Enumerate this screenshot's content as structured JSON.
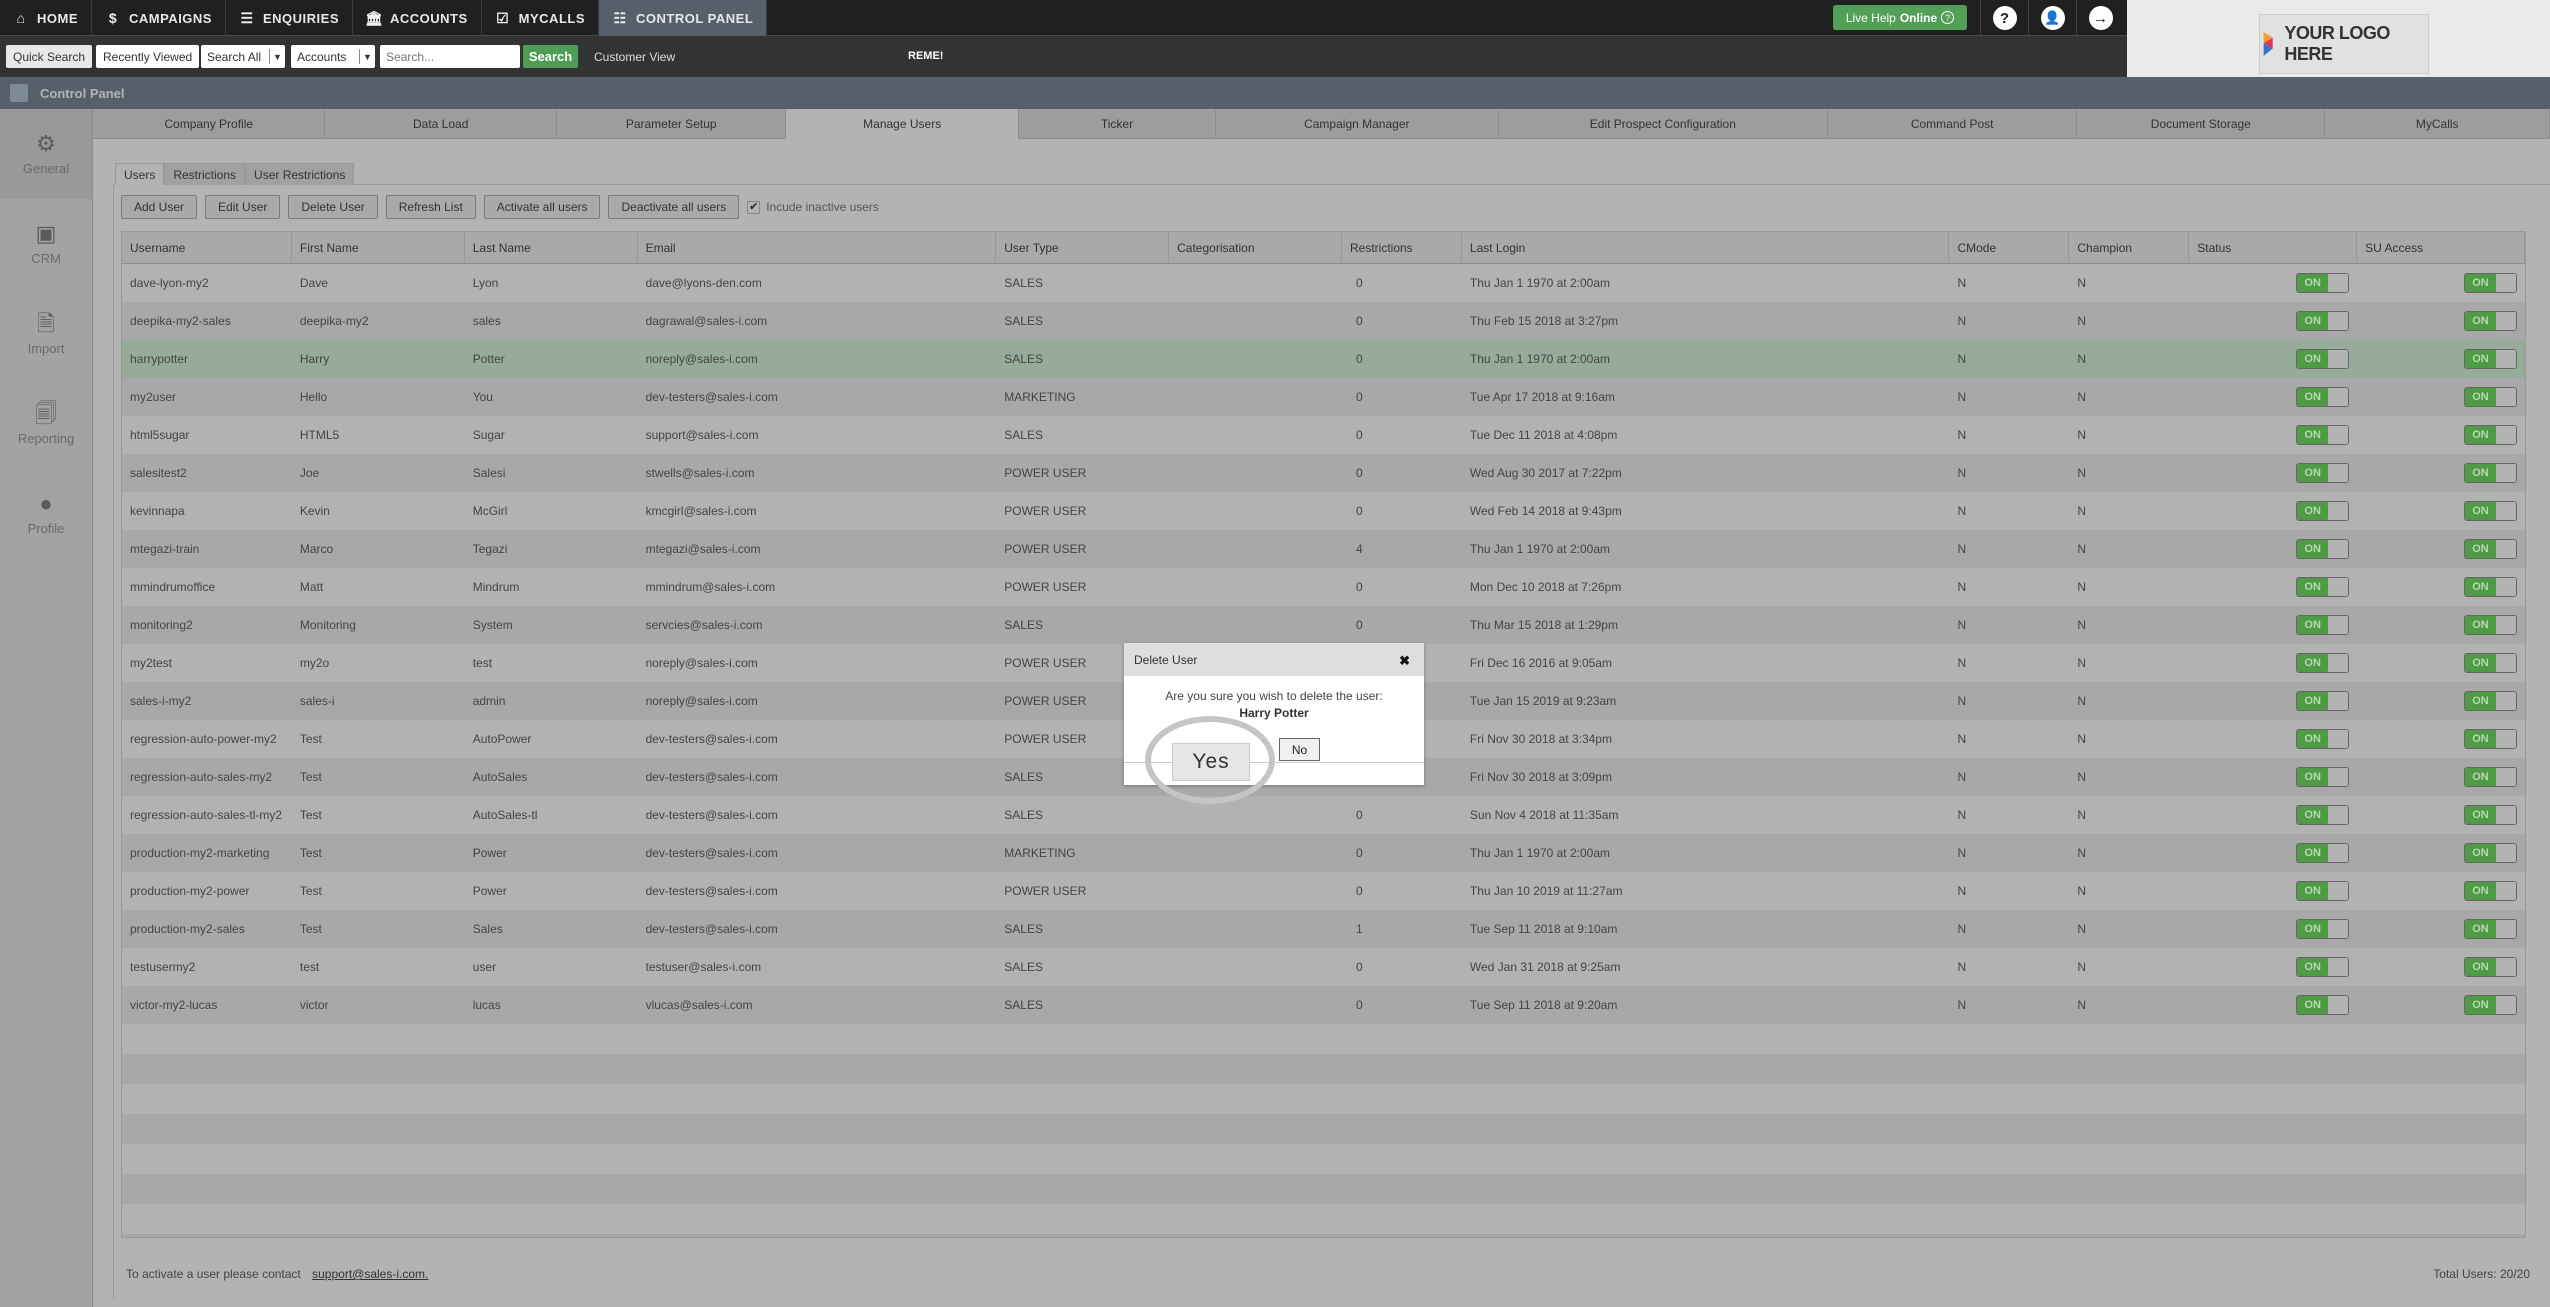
{
  "topnav": {
    "items": [
      {
        "label": "HOME",
        "icon": "home-icon",
        "glyph": "⌂"
      },
      {
        "label": "CAMPAIGNS",
        "icon": "campaigns-icon",
        "glyph": "$"
      },
      {
        "label": "ENQUIRIES",
        "icon": "enquiries-icon",
        "glyph": "☰"
      },
      {
        "label": "ACCOUNTS",
        "icon": "accounts-bank-icon",
        "glyph": "🏛"
      },
      {
        "label": "MYCALLS",
        "icon": "mycalls-checklist-icon",
        "glyph": "☑"
      },
      {
        "label": "CONTROL PANEL",
        "icon": "control-panel-icon",
        "glyph": "☷"
      }
    ],
    "active": "CONTROL PANEL",
    "live_help": {
      "text": "Live Help",
      "status": "Online",
      "icon": "?"
    },
    "help_glyph": "?",
    "user_glyph": "👤",
    "logout_glyph": "→"
  },
  "toolbar": {
    "quick_search": "Quick Search",
    "recently_viewed": "Recently Viewed",
    "scope_select": "Search All",
    "entity_select": "Accounts",
    "search_placeholder": "Search...",
    "search_button": "Search",
    "customer_view": "Customer View",
    "reme": "REME!"
  },
  "logo": {
    "text": "YOUR LOGO HERE"
  },
  "control_panel_title": "Control Panel",
  "sidebar": [
    {
      "label": "General",
      "glyph": "⚙",
      "icon": "gear-icon"
    },
    {
      "label": "CRM",
      "glyph": "▣",
      "icon": "crm-card-icon"
    },
    {
      "label": "Import",
      "glyph": "🗎",
      "icon": "import-file-icon"
    },
    {
      "label": "Reporting",
      "glyph": "🗐",
      "icon": "reporting-doc-icon"
    },
    {
      "label": "Profile",
      "glyph": "●",
      "icon": "profile-person-icon"
    }
  ],
  "tabs": [
    "Company Profile",
    "Data Load",
    "Parameter Setup",
    "Manage Users",
    "Ticker",
    "Campaign Manager",
    "Edit Prospect Configuration",
    "Command Post",
    "Document Storage",
    "MyCalls"
  ],
  "active_tab": "Manage Users",
  "subtabs": [
    "Users",
    "Restrictions",
    "User Restrictions"
  ],
  "actions": [
    "Add User",
    "Edit User",
    "Delete User",
    "Refresh List",
    "Activate all users",
    "Deactivate all users"
  ],
  "include_inactive": {
    "label": "Incude inactive users",
    "checked": true
  },
  "table": {
    "columns": [
      "Username",
      "First Name",
      "Last Name",
      "Email",
      "User Type",
      "Categorisation",
      "Restrictions",
      "Last Login",
      "CMode",
      "Champion",
      "Status",
      "SU Access"
    ],
    "rows": [
      [
        "dave-lyon-my2",
        "Dave",
        "Lyon",
        "dave@lyons-den.com",
        "SALES",
        "",
        "0",
        "Thu Jan 1 1970 at 2:00am",
        "N",
        "N",
        "ON",
        "ON"
      ],
      [
        "deepika-my2-sales",
        "deepika-my2",
        "sales",
        "dagrawal@sales-i.com",
        "SALES",
        "",
        "0",
        "Thu Feb 15 2018 at 3:27pm",
        "N",
        "N",
        "ON",
        "ON"
      ],
      [
        "harrypotter",
        "Harry",
        "Potter",
        "noreply@sales-i.com",
        "SALES",
        "",
        "0",
        "Thu Jan 1 1970 at 2:00am",
        "N",
        "N",
        "ON",
        "ON"
      ],
      [
        "my2user",
        "Hello",
        "You",
        "dev-testers@sales-i.com",
        "MARKETING",
        "",
        "0",
        "Tue Apr 17 2018 at 9:16am",
        "N",
        "N",
        "ON",
        "ON"
      ],
      [
        "html5sugar",
        "HTML5",
        "Sugar",
        "support@sales-i.com",
        "SALES",
        "",
        "0",
        "Tue Dec 11 2018 at 4:08pm",
        "N",
        "N",
        "ON",
        "ON"
      ],
      [
        "salesitest2",
        "Joe",
        "Salesi",
        "stwells@sales-i.com",
        "POWER USER",
        "",
        "0",
        "Wed Aug 30 2017 at 7:22pm",
        "N",
        "N",
        "ON",
        "ON"
      ],
      [
        "kevinnapa",
        "Kevin",
        "McGirl",
        "kmcgirl@sales-i.com",
        "POWER USER",
        "",
        "0",
        "Wed Feb 14 2018 at 9:43pm",
        "N",
        "N",
        "ON",
        "ON"
      ],
      [
        "mtegazi-train",
        "Marco",
        "Tegazi",
        "mtegazi@sales-i.com",
        "POWER USER",
        "",
        "4",
        "Thu Jan 1 1970 at 2:00am",
        "N",
        "N",
        "ON",
        "ON"
      ],
      [
        "mmindrumoffice",
        "Matt",
        "Mindrum",
        "mmindrum@sales-i.com",
        "POWER USER",
        "",
        "0",
        "Mon Dec 10 2018 at 7:26pm",
        "N",
        "N",
        "ON",
        "ON"
      ],
      [
        "monitoring2",
        "Monitoring",
        "System",
        "servcies@sales-i.com",
        "SALES",
        "",
        "0",
        "Thu Mar 15 2018 at 1:29pm",
        "N",
        "N",
        "ON",
        "ON"
      ],
      [
        "my2test",
        "my2o",
        "test",
        "noreply@sales-i.com",
        "POWER USER",
        "",
        "",
        "Fri Dec 16 2016 at 9:05am",
        "N",
        "N",
        "ON",
        "ON"
      ],
      [
        "sales-i-my2",
        "sales-i",
        "admin",
        "noreply@sales-i.com",
        "POWER USER",
        "",
        "",
        "Tue Jan 15 2019 at 9:23am",
        "N",
        "N",
        "ON",
        "ON"
      ],
      [
        "regression-auto-power-my2",
        "Test",
        "AutoPower",
        "dev-testers@sales-i.com",
        "POWER USER",
        "",
        "",
        "Fri Nov 30 2018 at 3:34pm",
        "N",
        "N",
        "ON",
        "ON"
      ],
      [
        "regression-auto-sales-my2",
        "Test",
        "AutoSales",
        "dev-testers@sales-i.com",
        "SALES",
        "",
        "",
        "Fri Nov 30 2018 at 3:09pm",
        "N",
        "N",
        "ON",
        "ON"
      ],
      [
        "regression-auto-sales-tl-my2",
        "Test",
        "AutoSales-tl",
        "dev-testers@sales-i.com",
        "SALES",
        "",
        "0",
        "Sun Nov 4 2018 at 11:35am",
        "N",
        "N",
        "ON",
        "ON"
      ],
      [
        "production-my2-marketing",
        "Test",
        "Power",
        "dev-testers@sales-i.com",
        "MARKETING",
        "",
        "0",
        "Thu Jan 1 1970 at 2:00am",
        "N",
        "N",
        "ON",
        "ON"
      ],
      [
        "production-my2-power",
        "Test",
        "Power",
        "dev-testers@sales-i.com",
        "POWER USER",
        "",
        "0",
        "Thu Jan 10 2019 at 11:27am",
        "N",
        "N",
        "ON",
        "ON"
      ],
      [
        "production-my2-sales",
        "Test",
        "Sales",
        "dev-testers@sales-i.com",
        "SALES",
        "",
        "1",
        "Tue Sep 11 2018 at 9:10am",
        "N",
        "N",
        "ON",
        "ON"
      ],
      [
        "testusermy2",
        "test",
        "user",
        "testuser@sales-i.com",
        "SALES",
        "",
        "0",
        "Wed Jan 31 2018 at 9:25am",
        "N",
        "N",
        "ON",
        "ON"
      ],
      [
        "victor-my2-lucas",
        "victor",
        "lucas",
        "vlucas@sales-i.com",
        "SALES",
        "",
        "0",
        "Tue Sep 11 2018 at 9:20am",
        "N",
        "N",
        "ON",
        "ON"
      ]
    ],
    "selected_row": 2
  },
  "footer": {
    "note": "To activate a user please contact",
    "link": "support@sales-i.com.",
    "total": "Total Users: 20/20"
  },
  "dialog": {
    "title": "Delete User",
    "close_glyph": "✖",
    "message": "Are you sure you wish to delete the user:",
    "user_name": "Harry Potter",
    "yes": "Yes",
    "no": "No"
  },
  "colors": {
    "accent_green": "#4f9d54",
    "toggle_on": "#4f9a45",
    "selected_row": "#97ab9a",
    "nav_active": "#55606b"
  }
}
